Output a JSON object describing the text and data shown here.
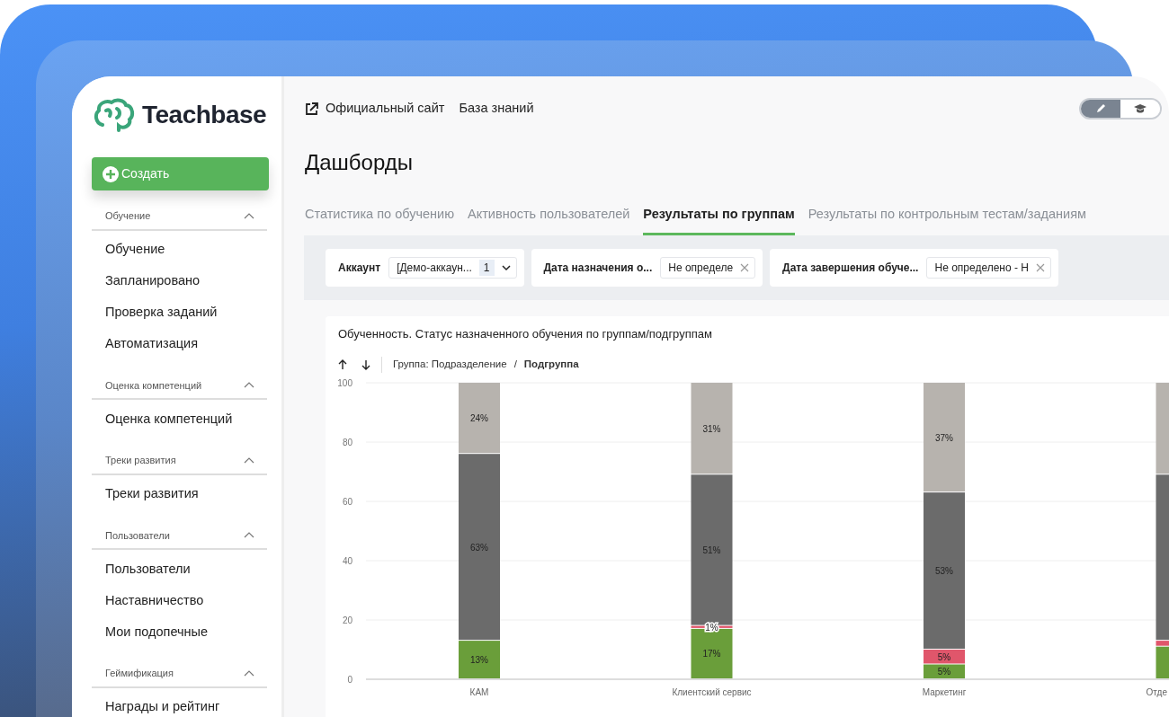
{
  "brand": {
    "name": "Teachbase"
  },
  "create_button": {
    "label": "Создать"
  },
  "sidebar": {
    "sections": [
      {
        "title": "Обучение",
        "expanded": true,
        "items": [
          {
            "label": "Обучение"
          },
          {
            "label": "Запланировано"
          },
          {
            "label": "Проверка заданий"
          },
          {
            "label": "Автоматизация"
          }
        ]
      },
      {
        "title": "Оценка компетенций",
        "expanded": true,
        "items": [
          {
            "label": "Оценка компетенций"
          }
        ]
      },
      {
        "title": "Треки развития",
        "expanded": true,
        "items": [
          {
            "label": "Треки развития"
          }
        ]
      },
      {
        "title": "Пользователи",
        "expanded": true,
        "items": [
          {
            "label": "Пользователи"
          },
          {
            "label": "Наставничество"
          },
          {
            "label": "Мои подопечные"
          }
        ]
      },
      {
        "title": "Геймификация",
        "expanded": true,
        "items": [
          {
            "label": "Награды и рейтинг"
          }
        ]
      }
    ]
  },
  "top_links": [
    {
      "label": "Официальный сайт",
      "external": true
    },
    {
      "label": "База знаний",
      "external": false
    }
  ],
  "mode_toggle": [
    {
      "kind": "edit",
      "selected": true
    },
    {
      "kind": "learn",
      "selected": false
    }
  ],
  "page_title": "Дашборды",
  "tabs": [
    {
      "label": "Статистика по обучению",
      "selected": false
    },
    {
      "label": "Активность пользователей",
      "selected": false
    },
    {
      "label": "Результаты по группам",
      "selected": true
    },
    {
      "label": "Результаты по контрольным тестам/заданиям",
      "selected": false
    }
  ],
  "filters": [
    {
      "label": "Аккаунт",
      "value": "[Демо-аккаун...",
      "count": "1",
      "kind": "select"
    },
    {
      "label": "Дата назначения о...",
      "value": "Не определе",
      "kind": "clearable"
    },
    {
      "label": "Дата завершения обуче...",
      "value": "Не определено - Н",
      "kind": "clearable"
    }
  ],
  "chart_card": {
    "title": "Обученность. Статус назначенного обучения по группам/подгруппам",
    "breadcrumb_separator": "/",
    "breadcrumbs": [
      {
        "label": "Группа: Подразделение",
        "selected": false
      },
      {
        "label": "Подгруппа",
        "selected": true
      }
    ],
    "chart_data": {
      "type": "bar",
      "stacked": true,
      "orientation": "vertical",
      "grid": true,
      "categories": [
        "КАМ",
        "Клиентский сервис",
        "Маркетинг",
        "Отде"
      ],
      "ylim": [
        0,
        100
      ],
      "yticks": [
        0,
        20,
        40,
        60,
        80,
        100
      ],
      "series": [
        {
          "color": "#6a9e3a",
          "values": [
            13,
            17,
            5,
            11
          ],
          "value_labels": [
            "13%",
            "17%",
            "5%",
            null
          ]
        },
        {
          "color": "#e0566b",
          "values": [
            0,
            1,
            5,
            2
          ],
          "value_labels": [
            null,
            "1%",
            "5%",
            null
          ]
        },
        {
          "color": "#6b6b6b",
          "values": [
            63,
            51,
            53,
            56
          ],
          "value_labels": [
            "63%",
            "51%",
            "53%",
            null
          ]
        },
        {
          "color": "#b7b3ae",
          "values": [
            24,
            31,
            37,
            31
          ],
          "value_labels": [
            "24%",
            "31%",
            "37%",
            null
          ]
        }
      ]
    }
  }
}
